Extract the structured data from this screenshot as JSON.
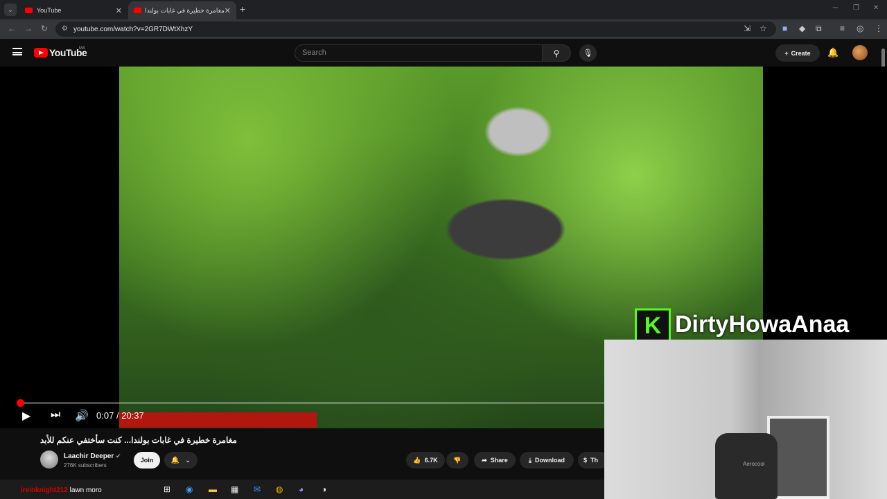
{
  "browser": {
    "tabs": [
      {
        "title": "YouTube",
        "active": false
      },
      {
        "title": "مغامرة خطيرة في غابات بولندا...",
        "active": true
      }
    ],
    "url": "youtube.com/watch?v=2GR7DWtXhzY"
  },
  "youtube": {
    "logo_text": "YouTube",
    "region_badge": "MA",
    "search_placeholder": "Search",
    "create_label": "Create"
  },
  "player": {
    "current_time": "0:07",
    "separator": "/",
    "duration": "20:37",
    "progress_fraction": 0.0057
  },
  "video": {
    "title": "مغامرة خطيرة في غابات بولندا... كنت سأختفي عنكم للأبد",
    "channel_name": "Laachir Deeper",
    "subscribers": "276K subscribers",
    "join_label": "Join",
    "likes": "6.7K",
    "share_label": "Share",
    "download_label": "Download",
    "thanks_label": "Th"
  },
  "stream_overlay": {
    "platform_letter": "K",
    "streamer_name": "DirtyHowaAnaa",
    "chat_user": "ireinknight212",
    "chat_message": "lawn moro",
    "chair_brand": "Aerocool"
  },
  "colors": {
    "accent_red": "#ff0000",
    "kick_green": "#53fc18"
  }
}
